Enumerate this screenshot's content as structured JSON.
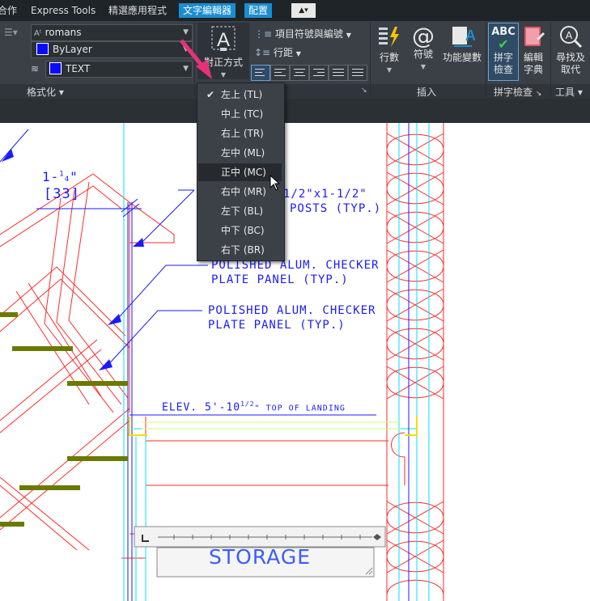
{
  "tabs": {
    "t0": "合作",
    "t1": "Express Tools",
    "t2": "精選應用程式",
    "t3": "文字編輯器",
    "t4": "配置",
    "t5": "▲▾"
  },
  "ribbon": {
    "format": {
      "font": "romans",
      "color": "ByLayer",
      "layer": "TEXT",
      "title": "格式化"
    },
    "paragraph": {
      "justify_label": "對正方式",
      "bullets": "項目符號與編號",
      "spacing": "行距"
    },
    "insert": {
      "columns": "行數",
      "symbol": "符號",
      "field": "功能變數",
      "title": "插入"
    },
    "spell": {
      "check": "拼字\n檢查",
      "dict": "編輯\n字典",
      "title": "拼字檢查"
    },
    "tools": {
      "find": "尋找及\n取代",
      "title": "工具"
    }
  },
  "justify_menu": {
    "items": [
      "左上 (TL)",
      "中上 (TC)",
      "右上 (TR)",
      "左中 (ML)",
      "正中 (MC)",
      "右中 (MR)",
      "左下 (BL)",
      "中下 (BC)",
      "右下 (BR)"
    ],
    "checked": "左上 (TL)",
    "hovered": "正中 (MC)"
  },
  "drawing": {
    "dim_top": "1-",
    "dim_frac_num": "1",
    "dim_frac_den": "4",
    "dim_bottom": "[33]",
    "posts_1": "1/2\"x1-1/2\"",
    "posts_2": "POSTS (TYP.)",
    "panel_a1": "POLISHED ALUM. CHECKER",
    "panel_a2": "PLATE PANEL (TYP.)",
    "panel_b1": "POLISHED ALUM. CHECKER",
    "panel_b2": "PLATE PANEL (TYP.)",
    "elev": "ELEV. 5'-10",
    "elev_frac": "1/2",
    "elev_tail": "\" TOP OF LANDING",
    "storage": "STORAGE"
  },
  "colors": {
    "accent": "#1b8dd1",
    "cad_blue": "#1a1aff",
    "cad_red": "#ff2a2a",
    "cad_cyan": "#00e0ff",
    "cad_yellow": "#f0e000",
    "arrow_pink": "#e8317a"
  }
}
